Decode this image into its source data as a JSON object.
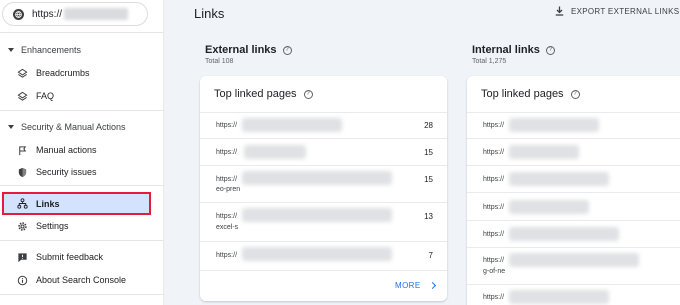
{
  "property": {
    "url": "https://"
  },
  "sidebar": {
    "enhancements": "Enhancements",
    "breadcrumbs": "Breadcrumbs",
    "faq": "FAQ",
    "security_section": "Security & Manual Actions",
    "manual_actions": "Manual actions",
    "security_issues": "Security issues",
    "links": "Links",
    "settings": "Settings",
    "submit_feedback": "Submit feedback",
    "about": "About Search Console"
  },
  "header": {
    "title": "Links",
    "export": "EXPORT EXTERNAL LINKS"
  },
  "external": {
    "title": "External links",
    "total": "Total 108",
    "card_title": "Top linked pages",
    "rows": [
      {
        "prefix": "https://",
        "suffix": "",
        "count": "28"
      },
      {
        "prefix": "https://",
        "suffix": "",
        "count": "15"
      },
      {
        "prefix": "https://",
        "suffix": "eo-pren",
        "count": "15"
      },
      {
        "prefix": "https://",
        "suffix": "excel-s",
        "count": "13"
      },
      {
        "prefix": "https://",
        "suffix": "",
        "count": "7"
      }
    ],
    "more": "MORE"
  },
  "internal": {
    "title": "Internal links",
    "total": "Total 1,275",
    "card_title": "Top linked pages",
    "rows": [
      {
        "prefix": "https://",
        "suffix": ""
      },
      {
        "prefix": "https://",
        "suffix": ""
      },
      {
        "prefix": "https://",
        "suffix": ""
      },
      {
        "prefix": "https://",
        "suffix": ""
      },
      {
        "prefix": "https://",
        "suffix": ""
      },
      {
        "prefix": "https://",
        "suffix": "g-of-ne"
      },
      {
        "prefix": "https://",
        "suffix": ""
      }
    ]
  },
  "colors": {
    "accent": "#1a73e8",
    "active_bg": "#d3e3fd",
    "highlight_border": "#e51a3d",
    "page_bg": "#f0f4f9"
  }
}
